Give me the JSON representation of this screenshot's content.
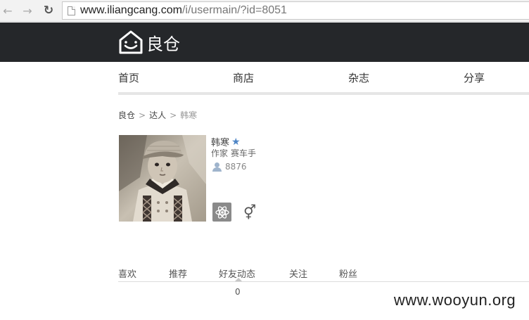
{
  "browser": {
    "back_icon": "arrow-left-icon",
    "forward_icon": "arrow-right-icon",
    "reload_icon": "reload-icon",
    "url_host": "www.iliangcang.com",
    "url_path": "/i/usermain/?id=8051"
  },
  "header": {
    "logo_text": "良仓",
    "background": "#25272a"
  },
  "nav": {
    "items": [
      "首页",
      "商店",
      "杂志",
      "分享"
    ]
  },
  "breadcrumb": {
    "items": [
      "良仓",
      "达人"
    ],
    "separator": ">",
    "current": "韩寒"
  },
  "profile": {
    "name": "韩寒",
    "verified_icon": "star-icon",
    "tags": [
      "作家",
      "赛车手"
    ],
    "visits_icon": "user-icon",
    "visits": "8876",
    "badge_icon": "atom-icon",
    "gender_icon": "male-female-icon",
    "accent": "#4f86c6"
  },
  "tabs": {
    "items": [
      "喜欢",
      "推荐",
      "好友动态",
      "关注",
      "粉丝"
    ],
    "active_index": 2,
    "active_count": "0"
  },
  "watermark": {
    "text": "www.wooyun.org"
  }
}
